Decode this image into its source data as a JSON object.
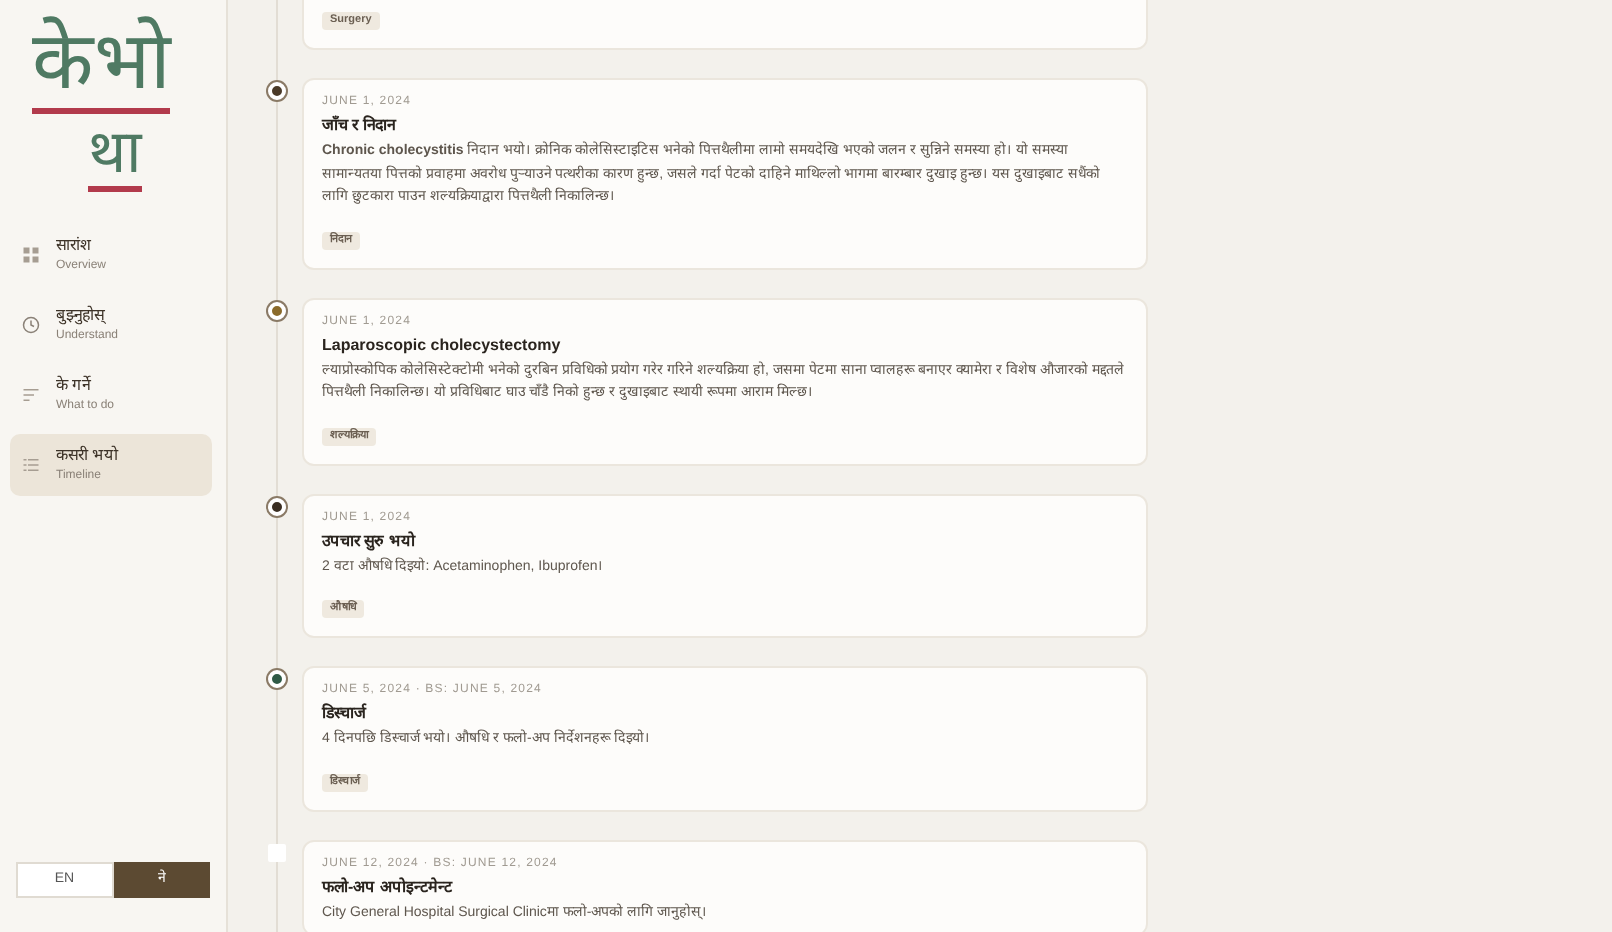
{
  "logo": {
    "lines": [
      "केभो",
      "था"
    ]
  },
  "nav": [
    {
      "label": "सारांश",
      "sublabel": "Overview",
      "selected": false
    },
    {
      "label": "बुझ्नुहोस्",
      "sublabel": "Understand",
      "selected": false
    },
    {
      "label": "के गर्ने",
      "sublabel": "What to do",
      "selected": false
    },
    {
      "label": "कसरी भयो",
      "sublabel": "Timeline",
      "selected": true
    }
  ],
  "language": [
    {
      "label": "EN",
      "selected": false
    },
    {
      "label": "ने",
      "selected": true
    }
  ],
  "timeline": [
    {
      "tag": "Surgery"
    },
    {
      "color": "#4a3a28",
      "date": "JUNE 1, 2024",
      "title": "जाँच र निदान",
      "body": "**Chronic cholecystitis** निदान भयो। क्रोनिक कोलेसिस्टाइटिस भनेको पित्तथैलीमा लामो समयदेखि भएको जलन र सुन्निने समस्या हो। यो समस्या सामान्यतया पित्तको प्रवाहमा अवरोध पुर्‍याउने पत्थरीका कारण हुन्छ, जसले गर्दा पेटको दाहिने माथिल्लो भागमा बारम्बार दुखाइ हुन्छ। यस दुखाइबाट सधैंको लागि छुटकारा पाउन शल्यक्रियाद्वारा पित्तथैली निकालिन्छ।",
      "tag": "निदान"
    },
    {
      "color": "#8a6a2a",
      "date": "JUNE 1, 2024",
      "title": "Laparoscopic cholecystectomy",
      "body": "ल्याप्रोस्कोपिक कोलेसिस्टेक्टोमी भनेको दुरबिन प्रविधिको प्रयोग गरेर गरिने शल्यक्रिया हो, जसमा पेटमा साना प्वालहरू बनाएर क्यामेरा र विशेष औजारको मद्दतले पित्तथैली निकालिन्छ। यो प्रविधिबाट घाउ चाँडै निको हुन्छ र दुखाइबाट स्थायी रूपमा आराम मिल्छ।",
      "tag": "शल्यक्रिया"
    },
    {
      "color": "#3a2e22",
      "date": "JUNE 1, 2024",
      "title": "उपचार सुरु भयो",
      "body": "2 वटा औषधि दिइयो: Acetaminophen, Ibuprofen।",
      "tag": "औषधि"
    },
    {
      "color": "#2f5a46",
      "date": "JUNE 5, 2024 · BS: JUNE 5, 2024",
      "title": "डिस्चार्ज",
      "body": "4 दिनपछि डिस्चार्ज भयो। औषधि र फलो-अप निर्देशनहरू दिइयो।",
      "tag": "डिस्चार्ज"
    },
    {
      "color": "#ffffff",
      "date": "JUNE 12, 2024 · BS: JUNE 12, 2024",
      "title": "फलो-अप अपोइन्टमेन्ट",
      "body": "City General Hospital Surgical Clinicमा फलो-अपको लागि जानुहोस्।"
    }
  ]
}
